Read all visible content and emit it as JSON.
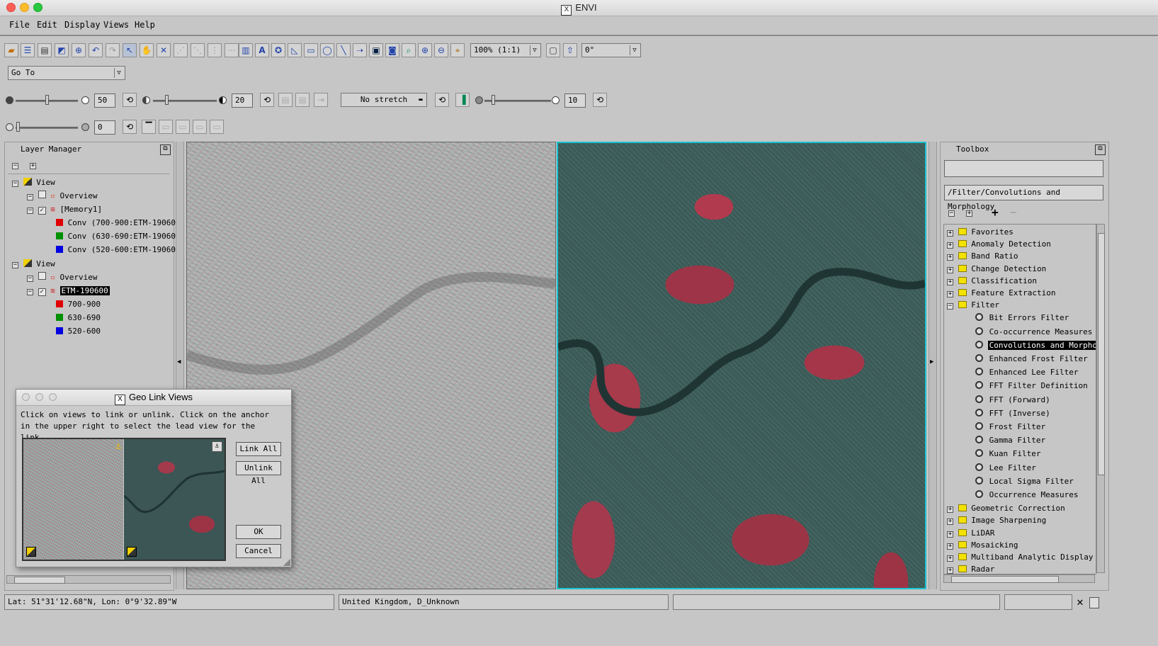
{
  "window": {
    "title": "ENVI",
    "x_badge": "X"
  },
  "menu": [
    "File",
    "Edit",
    "Display",
    "Views",
    "Help"
  ],
  "toolbar": {
    "zoom_value": "100% (1:1)",
    "rotation_value": "0°",
    "goto_value": "Go To"
  },
  "controls": {
    "brightness_value": "50",
    "contrast_value": "20",
    "stretch_value": "No stretch",
    "sharpen_value": "10",
    "transparency_value": "0"
  },
  "layer_manager": {
    "title": "Layer Manager",
    "view1": {
      "label": "View",
      "overview": "Overview",
      "layer": "[Memory1]",
      "bands": [
        {
          "label": "Conv (700-900:ETM-190600)",
          "color": "#e00000"
        },
        {
          "label": "Conv (630-690:ETM-190600)",
          "color": "#009000"
        },
        {
          "label": "Conv (520-600:ETM-190600)",
          "color": "#0000e0"
        }
      ]
    },
    "view2": {
      "label": "View",
      "overview": "Overview",
      "layer": "ETM-190600",
      "bands": [
        {
          "label": "700-900",
          "color": "#e00000"
        },
        {
          "label": "630-690",
          "color": "#009000"
        },
        {
          "label": "520-600",
          "color": "#0000e0"
        }
      ]
    }
  },
  "dialog": {
    "title": "Geo Link Views",
    "instruction": "Click on views to link or unlink. Click on the anchor in the upper right to select the lead view for the link.",
    "link_all": "Link All",
    "unlink_all": "Unlink All",
    "ok": "OK",
    "cancel": "Cancel"
  },
  "toolbox": {
    "title": "Toolbox",
    "search_value": "",
    "path_value": "/Filter/Convolutions and Morphology",
    "folders_top": [
      "Favorites",
      "Anomaly Detection",
      "Band Ratio",
      "Change Detection",
      "Classification",
      "Feature Extraction",
      "Filter"
    ],
    "filter_items": [
      "Bit Errors Filter",
      "Co-occurrence Measures",
      "Convolutions and Morpholog",
      "Enhanced Frost Filter",
      "Enhanced Lee Filter",
      "FFT Filter Definition",
      "FFT (Forward)",
      "FFT (Inverse)",
      "Frost Filter",
      "Gamma Filter",
      "Kuan Filter",
      "Lee Filter",
      "Local Sigma Filter",
      "Occurrence Measures"
    ],
    "selected_item": "Convolutions and Morpholog",
    "folders_bottom": [
      "Geometric Correction",
      "Image Sharpening",
      "LiDAR",
      "Mosaicking",
      "Multiband Analytic Display",
      "Radar"
    ]
  },
  "status": {
    "coords": "Lat: 51°31'12.68\"N, Lon: 0°9'32.89\"W",
    "projection": "United Kingdom, D_Unknown",
    "message": ""
  }
}
